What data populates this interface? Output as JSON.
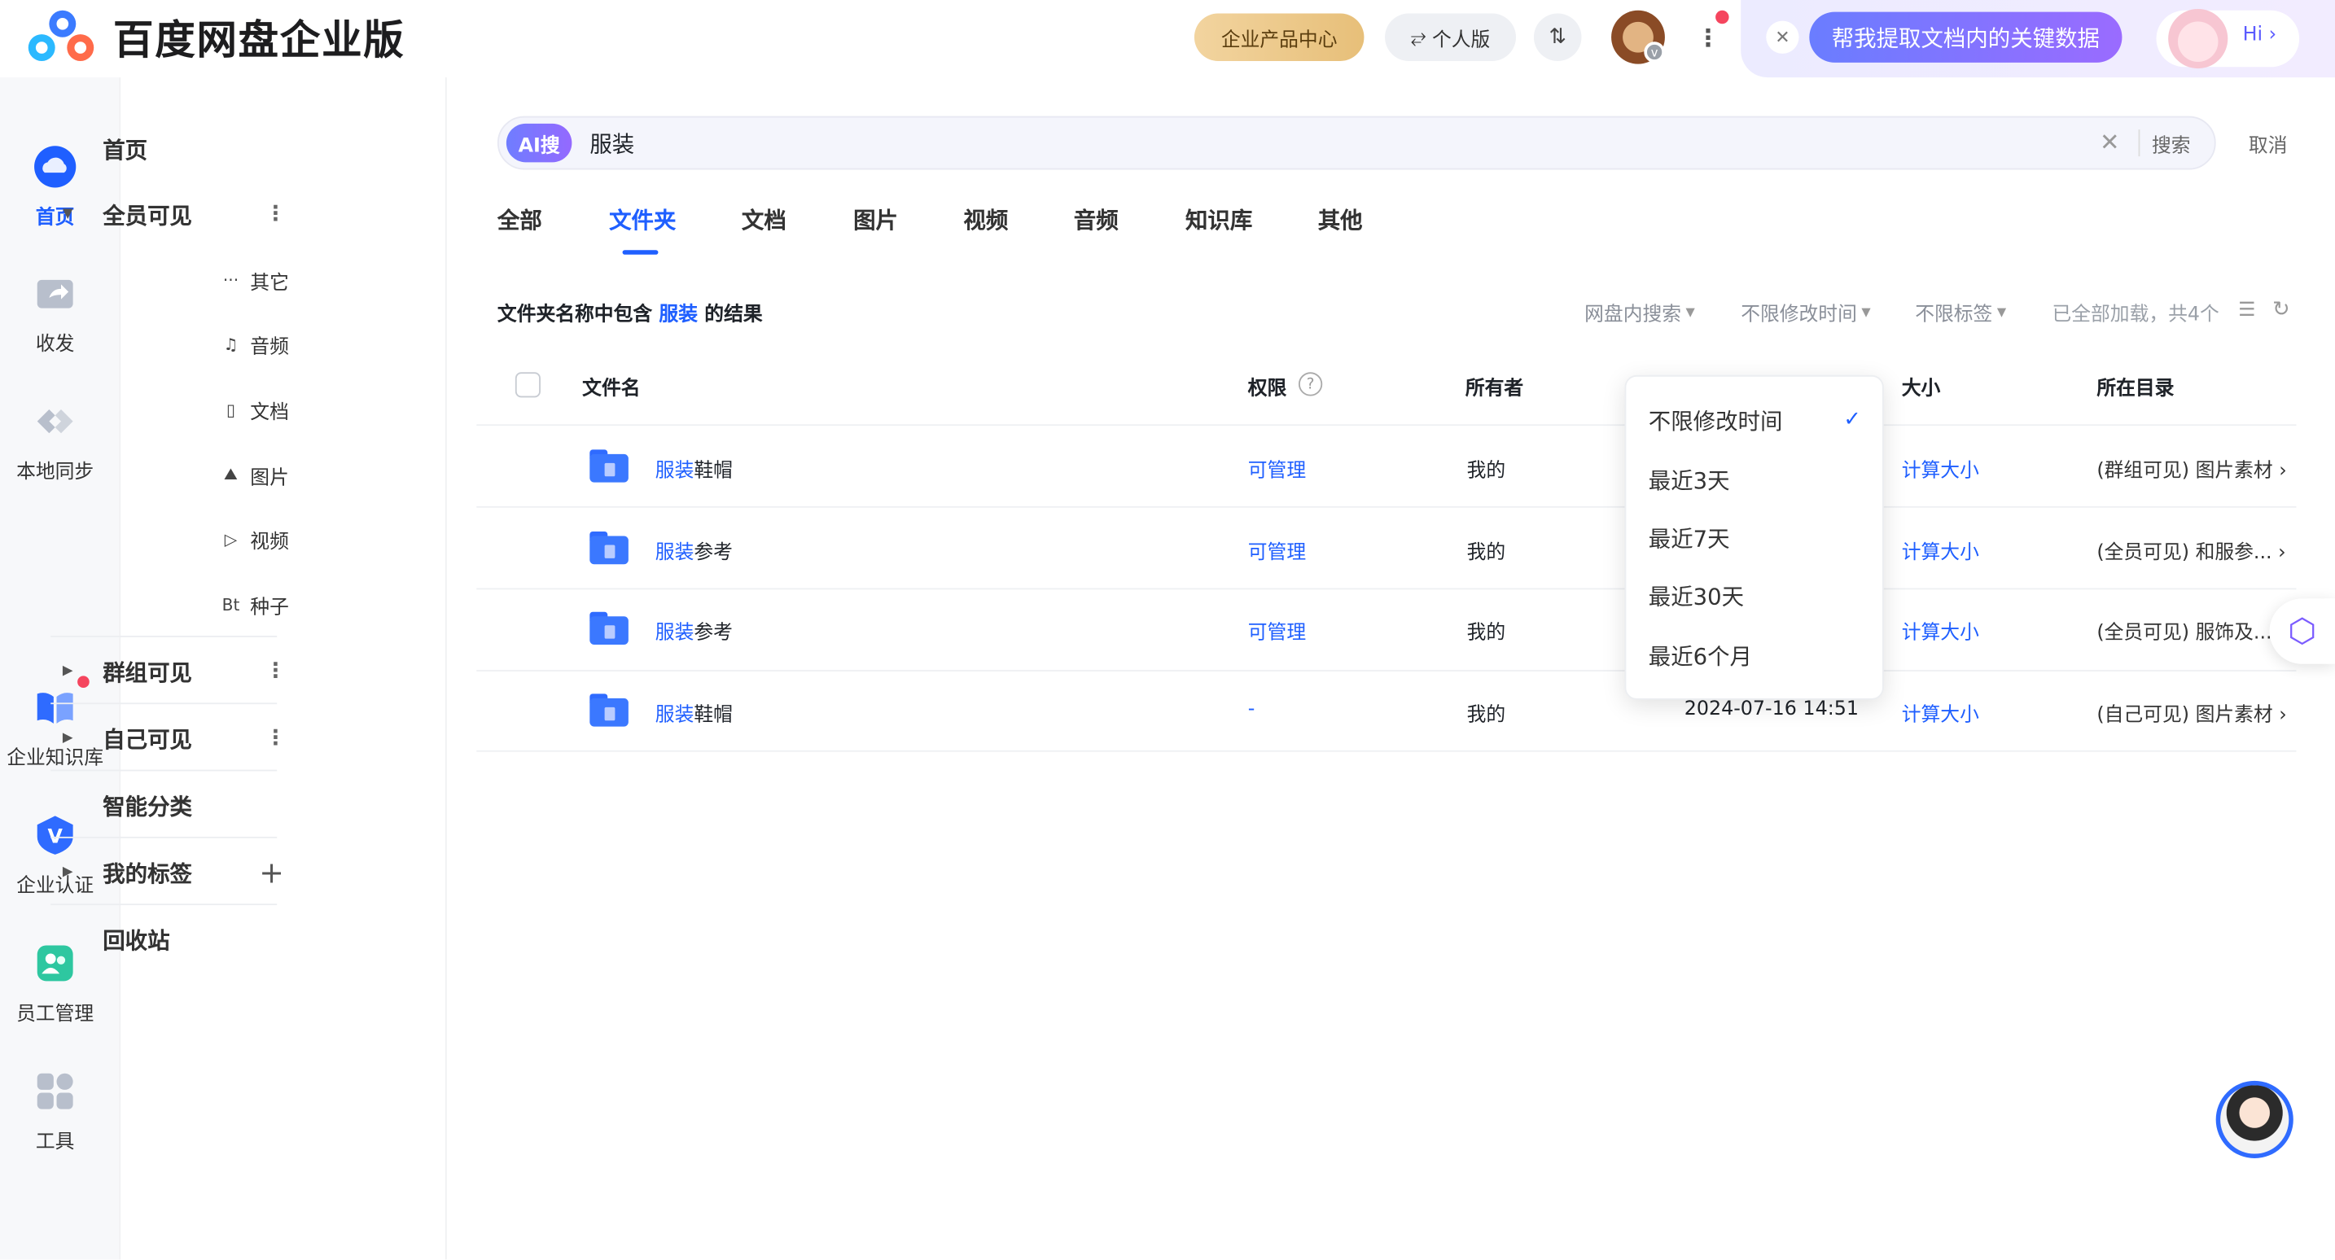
{
  "brand": {
    "title": "百度网盘企业版"
  },
  "topbar": {
    "enterprise_center": "企业产品中心",
    "personal": "个人版",
    "transfer_icon": "⇅",
    "ai_close": "✕",
    "ai_prompt": "帮我提取文档内的关键数据",
    "hi": "Hi ›"
  },
  "rail": [
    {
      "label": "首页",
      "icon": "cloud-icon",
      "active": true
    },
    {
      "label": "收发",
      "icon": "share-folder-icon"
    },
    {
      "label": "本地同步",
      "icon": "sync-icon"
    },
    {
      "label": "企业知识库",
      "icon": "book-icon",
      "badge": true
    },
    {
      "label": "企业认证",
      "icon": "verified-icon"
    },
    {
      "label": "员工管理",
      "icon": "staff-icon"
    },
    {
      "label": "工具",
      "icon": "tools-icon"
    }
  ],
  "nav": {
    "home": "首页",
    "all_visible": "全员可见",
    "sub": [
      {
        "icon": "···",
        "label": "其它"
      },
      {
        "icon": "♫",
        "label": "音频"
      },
      {
        "icon": "▯",
        "label": "文档"
      },
      {
        "icon": "⛰",
        "label": "图片"
      },
      {
        "icon": "▷",
        "label": "视频"
      },
      {
        "icon": "Bt",
        "label": "种子"
      }
    ],
    "group_visible": "群组可见",
    "self_visible": "自己可见",
    "smart": "智能分类",
    "tags": "我的标签",
    "recycle": "回收站",
    "kebab": "⋮",
    "plus": "+"
  },
  "search": {
    "ai_tag": "AI搜",
    "query": "服装",
    "clear": "✕",
    "button": "搜索",
    "cancel": "取消"
  },
  "tabs": [
    "全部",
    "文件夹",
    "文档",
    "图片",
    "视频",
    "音频",
    "知识库",
    "其他"
  ],
  "active_tab": "文件夹",
  "result": {
    "prefix": "文件夹名称中包含 ",
    "keyword": "服装",
    "suffix": " 的结果"
  },
  "filters": {
    "scope": "网盘内搜索",
    "time": "不限修改时间",
    "tag": "不限标签",
    "count": "已全部加载，共4个",
    "list_icon": "☰",
    "refresh_icon": "↻"
  },
  "table": {
    "headers": {
      "name": "文件名",
      "perm": "权限",
      "owner": "所有者",
      "size": "大小",
      "dir": "所在目录"
    },
    "rows": [
      {
        "kw": "服装",
        "rest": "鞋帽",
        "perm": "可管理",
        "owner": "我的",
        "time": "",
        "size": "计算大小",
        "dir": "(群组可见) 图片素材 ›"
      },
      {
        "kw": "服装",
        "rest": "参考",
        "perm": "可管理",
        "owner": "我的",
        "time": "",
        "size": "计算大小",
        "dir": "(全员可见) 和服参... ›"
      },
      {
        "kw": "服装",
        "rest": "参考",
        "perm": "可管理",
        "owner": "我的",
        "time": "",
        "size": "计算大小",
        "dir": "(全员可见) 服饰及..."
      },
      {
        "kw": "服装",
        "rest": "鞋帽",
        "perm": "-",
        "owner": "我的",
        "time": "2024-07-16 14:51",
        "size": "计算大小",
        "dir": "(自己可见) 图片素材 ›"
      }
    ]
  },
  "time_dropdown": {
    "options": [
      "不限修改时间",
      "最近3天",
      "最近7天",
      "最近30天",
      "最近6个月"
    ],
    "selected": "不限修改时间",
    "check": "✓"
  },
  "colors": {
    "accent": "#1f5fff",
    "ai": "#7b6bff",
    "badge": "#f5455e"
  }
}
